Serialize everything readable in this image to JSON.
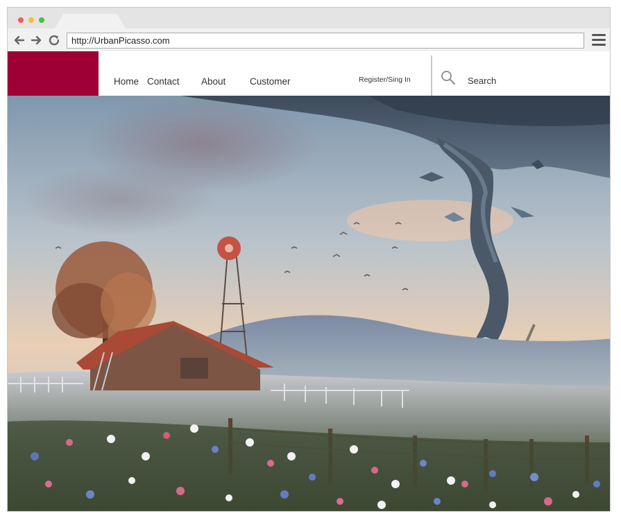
{
  "browser": {
    "url": "http://UrbanPicasso.com"
  },
  "site": {
    "nav": [
      "Home",
      "Contact",
      "About",
      "Customer"
    ],
    "register_label": "Register/Sing In",
    "search_label": "Search"
  },
  "colors": {
    "brand": "#9e0035"
  },
  "hero": {
    "subject": "painting"
  }
}
